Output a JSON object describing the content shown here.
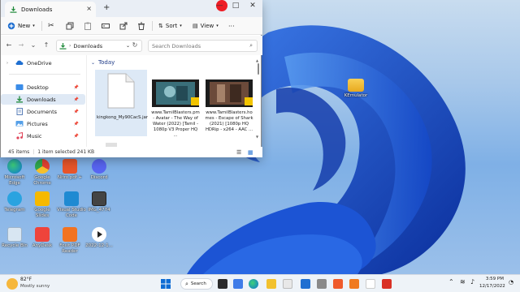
{
  "window": {
    "tab_title": "Downloads",
    "new_tab_glyph": "+",
    "tab_close_glyph": "×",
    "minimize_glyph": "—",
    "maximize_glyph": "□",
    "close_glyph": "✕"
  },
  "toolbar": {
    "new_label": "New",
    "sort_label": "Sort",
    "view_label": "View",
    "more_glyph": "···"
  },
  "address": {
    "location": "Downloads",
    "search_placeholder": "Search Downloads"
  },
  "sidebar": {
    "items": [
      {
        "label": "OneDrive",
        "icon": "cloud-icon"
      },
      {
        "label": "Desktop",
        "icon": "desktop-folder-icon"
      },
      {
        "label": "Downloads",
        "icon": "downloads-folder-icon"
      },
      {
        "label": "Documents",
        "icon": "documents-folder-icon"
      },
      {
        "label": "Pictures",
        "icon": "pictures-folder-icon"
      },
      {
        "label": "Music",
        "icon": "music-folder-icon"
      }
    ]
  },
  "content": {
    "group_label": "Today",
    "files": [
      {
        "name": "kingkong_My90CacS.jar",
        "icon": "blank-file-icon"
      },
      {
        "name": "www.TamilBlasters.pm - Avatar - The Way of Water (2022) [Tamil - 1080p V3 Proper HQ ...",
        "icon": "video-thumbnail-icon"
      },
      {
        "name": "www.TamilBlasters.ho mes - Escape of Shark (2021) [1080p HQ HDRip - x264 - AAC ...",
        "icon": "video-thumbnail-icon"
      }
    ]
  },
  "status": {
    "item_count": "45 items",
    "selection": "1 item selected  241 KB"
  },
  "desktop": {
    "icons": [
      {
        "label": "Microsoft Edge"
      },
      {
        "label": "Google Chrome"
      },
      {
        "label": "Nitro pdf +"
      },
      {
        "label": "Discord"
      },
      {
        "label": "Telegram"
      },
      {
        "label": "Google Slides"
      },
      {
        "label": "Visual Studio Code"
      },
      {
        "label": "IMG_4774"
      },
      {
        "label": "Recycle Bin"
      },
      {
        "label": "AnyDesk"
      },
      {
        "label": "Foxit PDF Reader"
      },
      {
        "label": "2022-12-1..."
      },
      {
        "label": "KEmulator"
      }
    ]
  },
  "taskbar": {
    "weather_temp": "82°F",
    "weather_desc": "Mostly sunny",
    "search_label": "Search",
    "time": "3:59 PM",
    "date": "12/17/2022"
  },
  "colors": {
    "accent": "#1f6fd1",
    "recording_dot": "#ee1c24",
    "selection": "#dde9f6",
    "taskbar": "#eef3f8"
  }
}
